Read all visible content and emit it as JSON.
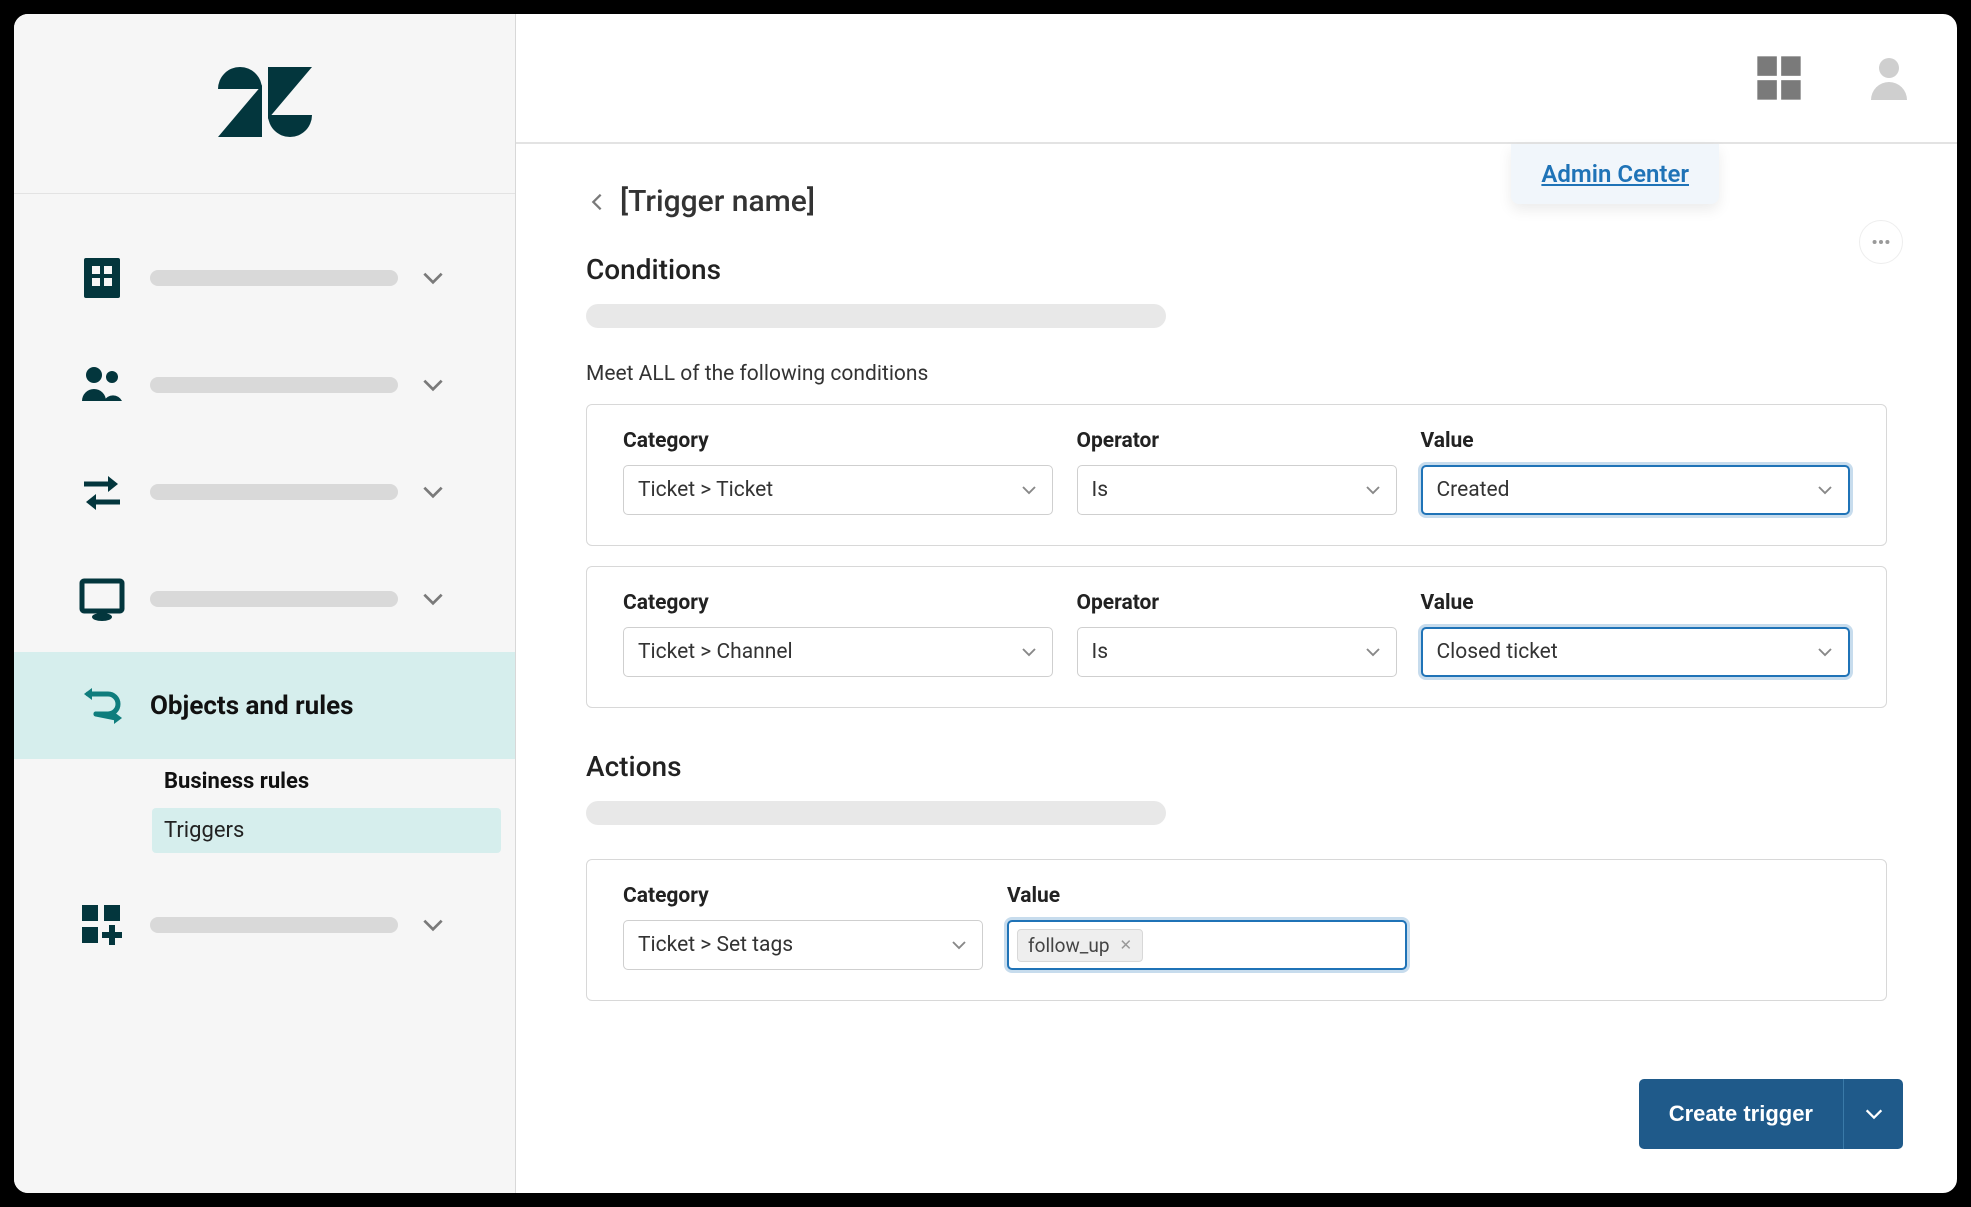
{
  "tooltip": {
    "label": "Admin Center"
  },
  "sidebar": {
    "objects_rules_label": "Objects and rules",
    "business_rules_label": "Business rules",
    "triggers_label": "Triggers"
  },
  "page": {
    "title": "[Trigger name]",
    "conditions_title": "Conditions",
    "meet_all_label": "Meet ALL of the following conditions",
    "actions_title": "Actions"
  },
  "labels": {
    "category": "Category",
    "operator": "Operator",
    "value": "Value"
  },
  "conditions": [
    {
      "category": "Ticket > Ticket",
      "operator": "Is",
      "value": "Created"
    },
    {
      "category": "Ticket > Channel",
      "operator": "Is",
      "value": "Closed ticket"
    }
  ],
  "action": {
    "category": "Ticket > Set tags",
    "tags": [
      "follow_up"
    ]
  },
  "footer": {
    "create_label": "Create trigger"
  }
}
